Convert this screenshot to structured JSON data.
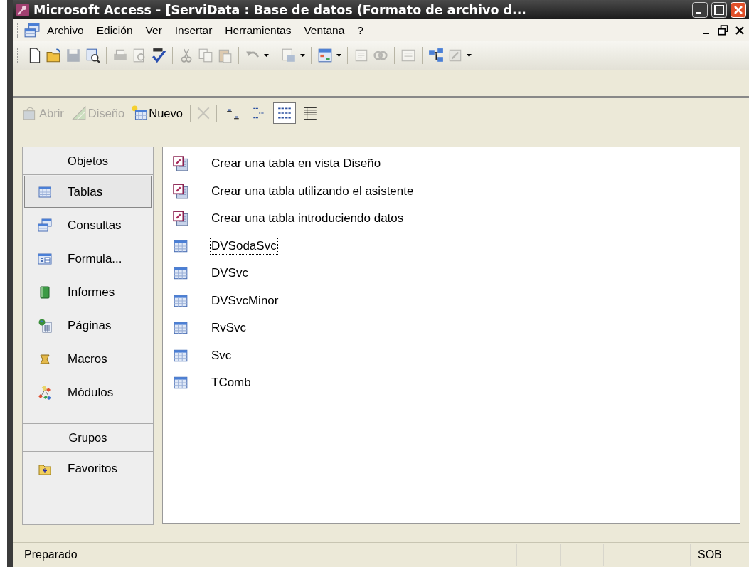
{
  "window": {
    "title": "Microsoft Access - [ServiData : Base de datos (Formato de archivo d..."
  },
  "menu": [
    "Archivo",
    "Edición",
    "Ver",
    "Insertar",
    "Herramientas",
    "Ventana",
    "?"
  ],
  "db_toolbar": {
    "buttons": [
      {
        "label": "Abrir",
        "disabled": true
      },
      {
        "label": "Diseño",
        "disabled": true
      },
      {
        "label": "Nuevo",
        "disabled": false
      }
    ],
    "views": [
      {
        "selected": false
      },
      {
        "selected": false
      },
      {
        "selected": true
      },
      {
        "selected": false
      }
    ]
  },
  "objects": {
    "header": "Objetos",
    "items": [
      {
        "label": "Tablas",
        "selected": true
      },
      {
        "label": "Consultas",
        "selected": false
      },
      {
        "label": "Formula...",
        "selected": false
      },
      {
        "label": "Informes",
        "selected": false
      },
      {
        "label": "Páginas",
        "selected": false
      },
      {
        "label": "Macros",
        "selected": false
      },
      {
        "label": "Módulos",
        "selected": false
      }
    ]
  },
  "groups": {
    "header": "Grupos",
    "items": [
      {
        "label": "Favoritos",
        "selected": false
      }
    ]
  },
  "list": [
    {
      "kind": "wizard",
      "label": "Crear una tabla en vista Diseño",
      "focused": false
    },
    {
      "kind": "wizard",
      "label": "Crear una tabla utilizando el asistente",
      "focused": false
    },
    {
      "kind": "wizard",
      "label": "Crear una tabla introduciendo datos",
      "focused": false
    },
    {
      "kind": "table",
      "label": "DVSodaSvc",
      "focused": true
    },
    {
      "kind": "table",
      "label": "DVSvc",
      "focused": false
    },
    {
      "kind": "table",
      "label": "DVSvcMinor",
      "focused": false
    },
    {
      "kind": "table",
      "label": "RvSvc",
      "focused": false
    },
    {
      "kind": "table",
      "label": "Svc",
      "focused": false
    },
    {
      "kind": "table",
      "label": "TComb",
      "focused": false
    }
  ],
  "status_bar": {
    "message": "Preparado",
    "indicator": "SOB"
  }
}
